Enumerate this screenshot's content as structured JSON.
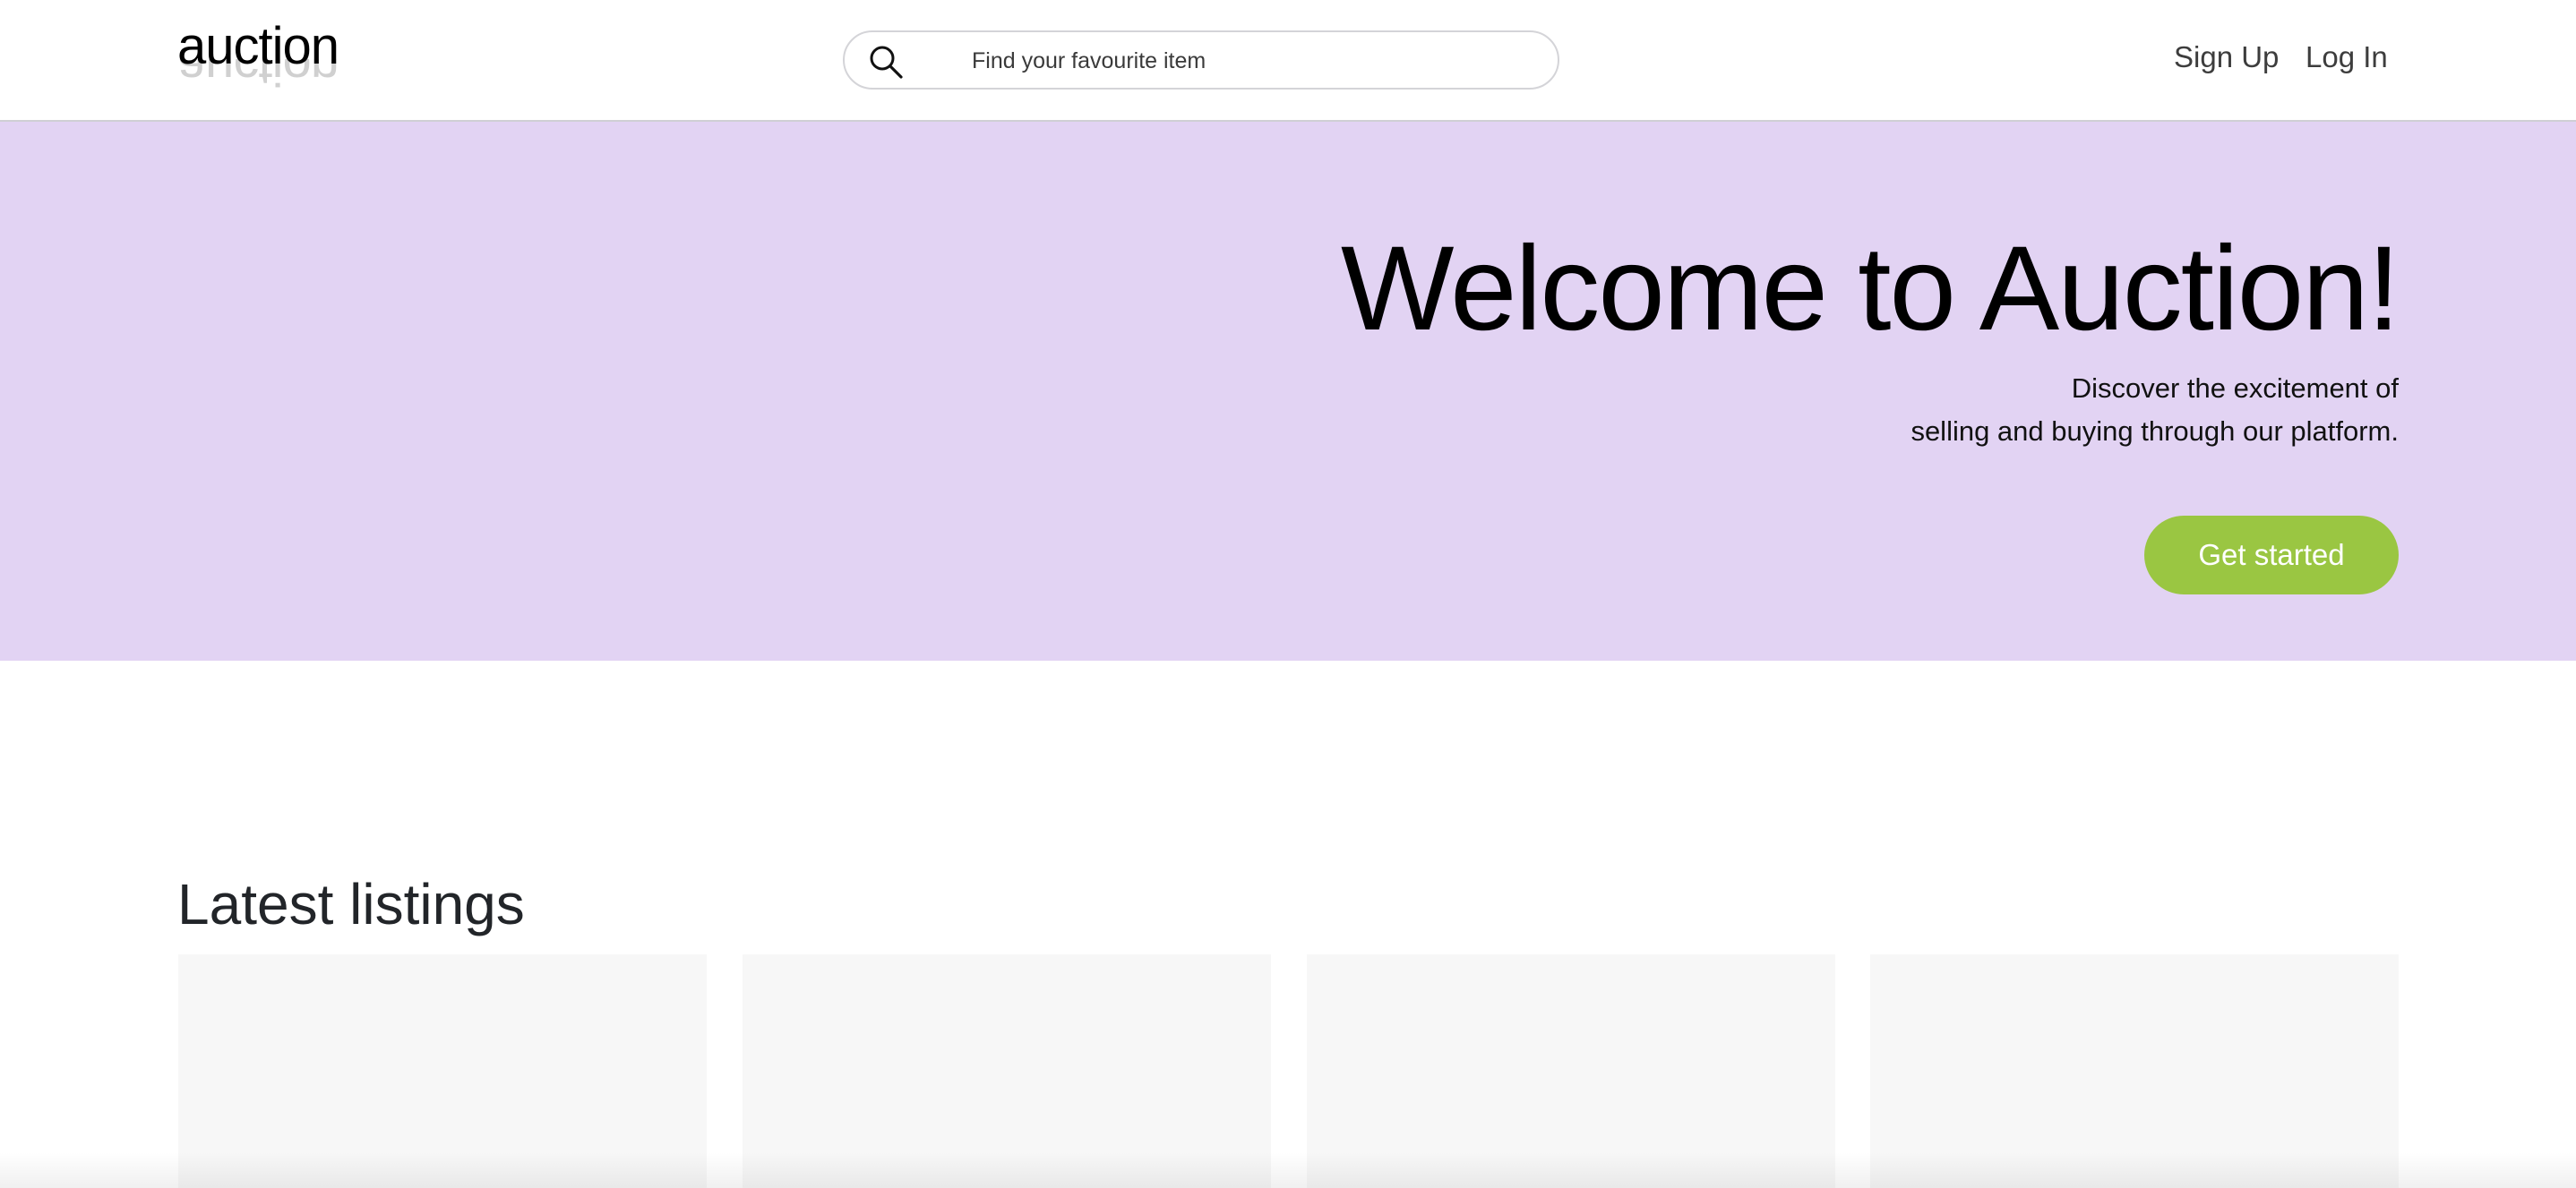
{
  "header": {
    "logo_text": "auction",
    "search": {
      "placeholder": "Find your favourite item",
      "value": ""
    },
    "nav": {
      "signup_label": "Sign Up",
      "login_label": "Log In"
    }
  },
  "hero": {
    "title": "Welcome to Auction!",
    "subtitle_line1": "Discover the excitement of",
    "subtitle_line2": "selling and buying through our platform.",
    "cta_label": "Get started",
    "background_color": "#e2d3f3",
    "cta_color": "#9ac642"
  },
  "listings": {
    "title": "Latest listings",
    "cards": [
      {},
      {},
      {},
      {}
    ]
  }
}
